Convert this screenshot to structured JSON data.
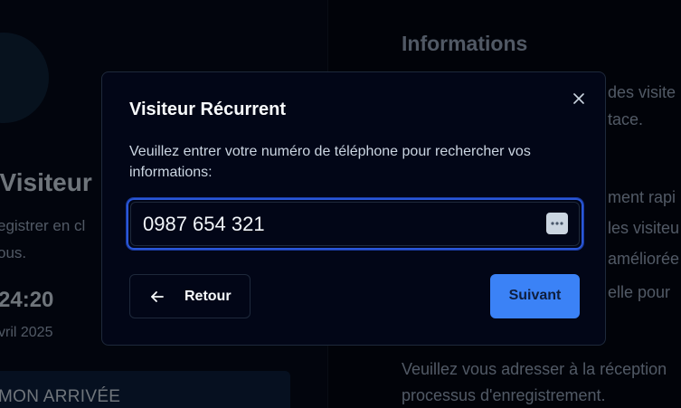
{
  "background": {
    "welcome_text": ", Visiteur",
    "subtitle_line1": "egistrer en cl",
    "subtitle_line2": "ous.",
    "time": "24:20",
    "date": "vril 2025",
    "arrival_button_label": "MON ARRIVÉE",
    "info_title": "Informations",
    "info_lines": [
      "des visite",
      "tace.",
      "ment rapi",
      "les visiteu",
      "améliorée",
      "elle pour",
      "Veuillez vous adresser à la réception",
      "processus d'enregistrement."
    ]
  },
  "modal": {
    "title": "Visiteur Récurrent",
    "description": "Veuillez entrer votre numéro de téléphone pour rechercher vos informations:",
    "phone_value": "0987 654 321",
    "back_label": "Retour",
    "next_label": "Suivant"
  },
  "icons": {
    "close": "close-icon",
    "back": "arrow-left-icon",
    "password_manager": "password-manager-icon",
    "check": "check-icon"
  },
  "colors": {
    "accent": "#3b82f6",
    "focus_ring": "#2a57d8",
    "modal_bg": "#020617"
  }
}
